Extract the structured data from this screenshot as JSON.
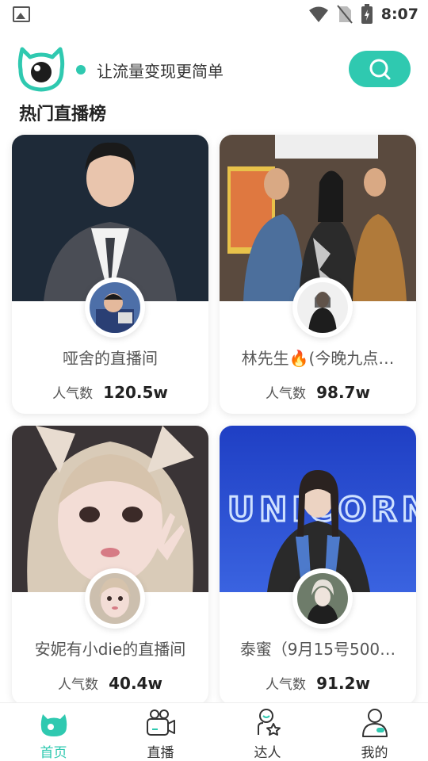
{
  "status_bar": {
    "time": "8:07"
  },
  "header": {
    "slogan": "让流量变现更简单"
  },
  "section": {
    "title": "热门直播榜"
  },
  "cards": [
    {
      "title": "哑舍的直播间",
      "pop_label": "人气数",
      "pop_value": "120.5w"
    },
    {
      "title": "林先生🔥(今晚九点…",
      "pop_label": "人气数",
      "pop_value": "98.7w"
    },
    {
      "title": "安妮有小die的直播间",
      "pop_label": "人气数",
      "pop_value": "40.4w"
    },
    {
      "title": "泰蜜（9月15号500…",
      "pop_label": "人气数",
      "pop_value": "91.2w"
    }
  ],
  "nav": [
    {
      "label": "首页",
      "icon": "home-icon",
      "active": true
    },
    {
      "label": "直播",
      "icon": "video-camera-icon",
      "active": false
    },
    {
      "label": "达人",
      "icon": "star-person-icon",
      "active": false
    },
    {
      "label": "我的",
      "icon": "user-icon",
      "active": false
    }
  ],
  "colors": {
    "accent": "#2fc9b0",
    "text": "#222222",
    "muted": "#555555"
  }
}
